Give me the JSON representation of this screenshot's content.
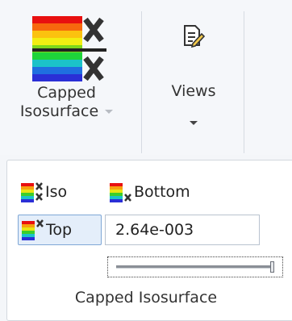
{
  "ribbon": {
    "capped_isosurface_button": {
      "label_line1": "Capped",
      "label_line2": "Isosurface",
      "icon": "capped-isosurface-icon"
    },
    "views_button": {
      "label": "Views",
      "icon": "views-document-icon"
    }
  },
  "capped_panel": {
    "iso_button": {
      "label": "Iso",
      "icon": "iso-icon"
    },
    "bottom_button": {
      "label": "Bottom",
      "icon": "bottom-icon"
    },
    "top_button": {
      "label": "Top",
      "icon": "top-icon"
    },
    "value_input": {
      "value": "2.64e-003"
    },
    "group_label": "Capped Isosurface",
    "slider": {
      "position": 1.0
    }
  }
}
